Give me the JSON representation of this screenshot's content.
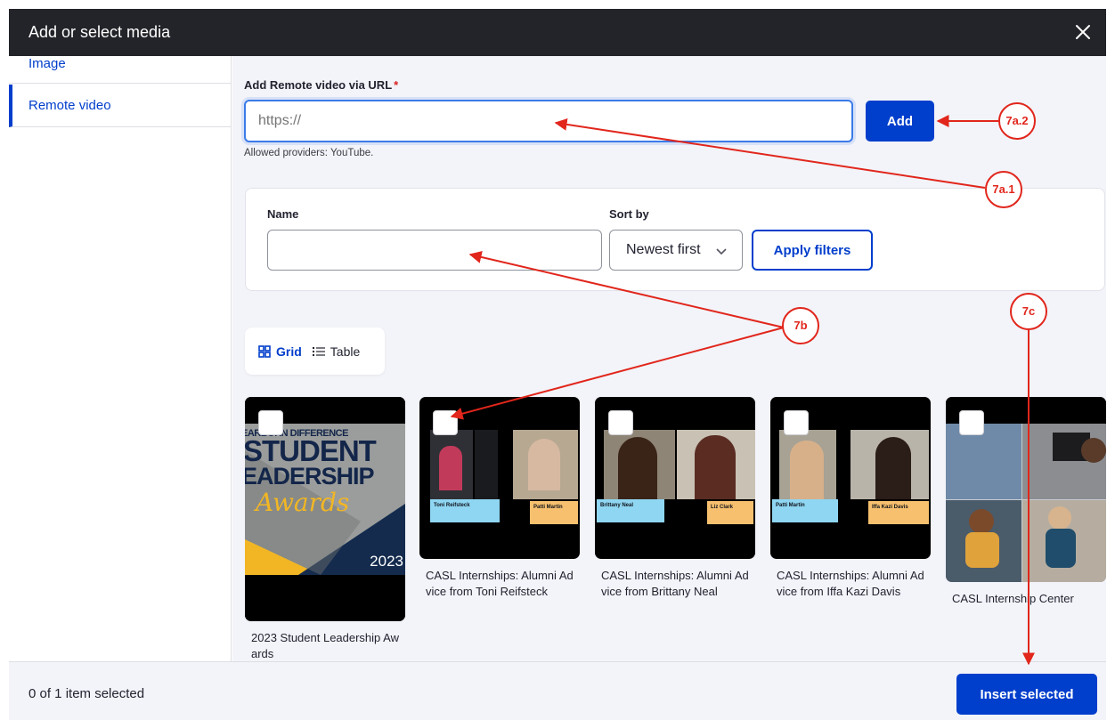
{
  "dialog": {
    "title": "Add or select media",
    "close_label": "close"
  },
  "sidebar": {
    "items": [
      {
        "label": "Image"
      },
      {
        "label": "Remote video"
      }
    ]
  },
  "url_form": {
    "label": "Add Remote video via URL",
    "required_mark": "*",
    "value": "",
    "placeholder": "https://",
    "add_label": "Add",
    "help": "Allowed providers: YouTube."
  },
  "filters": {
    "name_label": "Name",
    "name_value": "",
    "sort_label": "Sort by",
    "sort_value": "Newest first",
    "apply_label": "Apply filters"
  },
  "view_toggle": {
    "grid_label": "Grid",
    "table_label": "Table"
  },
  "media": [
    {
      "caption": "2023 Student Leadership Awards",
      "thumb_text": {
        "line1": "EARBORN DIFFERENCE",
        "line2": "STUDENT",
        "line3": "EADERSHIP",
        "script": "Awards",
        "year": "2023"
      }
    },
    {
      "caption": "CASL Internships: Alumni Advice from Toni Reifsteck",
      "thumb_text": {
        "left": "Toni Reifsteck",
        "right": "Patti Martin"
      }
    },
    {
      "caption": "CASL Internships: Alumni Advice from Brittany Neal",
      "thumb_text": {
        "left": "Brittany Neal",
        "right": "Liz Clark"
      }
    },
    {
      "caption": "CASL Internships: Alumni Advice from Iffa Kazi Davis",
      "thumb_text": {
        "left": "Patti Martin",
        "right": "Iffa Kazi Davis"
      }
    },
    {
      "caption": "CASL Internship Center"
    }
  ],
  "footer": {
    "count": "0 of 1 item selected",
    "insert_label": "Insert selected"
  },
  "callouts": {
    "a2": "7a.2",
    "a1": "7a.1",
    "b": "7b",
    "c": "7c"
  },
  "colors": {
    "accent": "#003ecc",
    "titlebar": "#232429",
    "annotation": "#e1261c"
  }
}
